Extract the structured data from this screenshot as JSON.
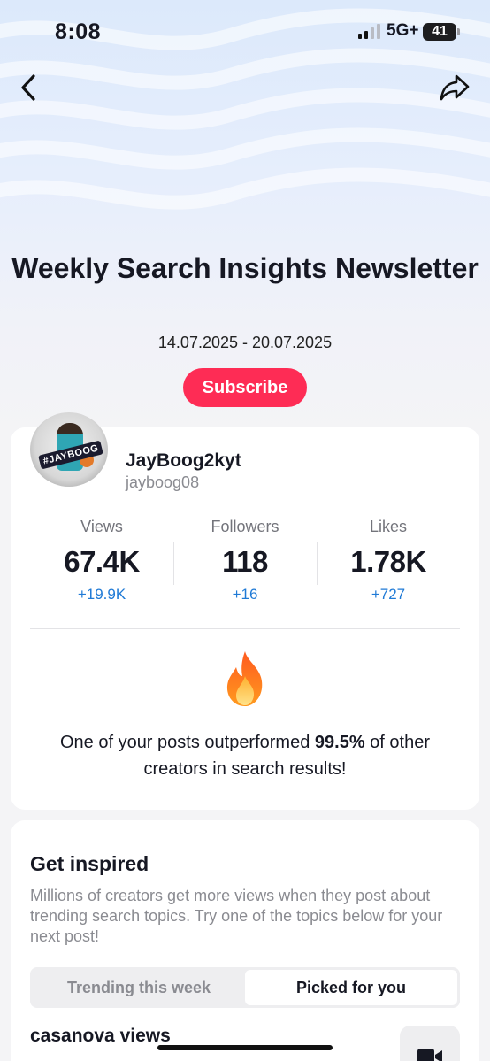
{
  "status_bar": {
    "time": "8:08",
    "network": "5G+",
    "battery": "41"
  },
  "header": {
    "title": "Weekly Search Insights Newsletter",
    "date_range": "14.07.2025 - 20.07.2025",
    "subscribe_label": "Subscribe"
  },
  "profile": {
    "display_name": "JayBoog2kyt",
    "username": "jayboog08",
    "avatar_text": "#JAYBOOG",
    "stats": [
      {
        "label": "Views",
        "value": "67.4K",
        "delta": "+19.9K"
      },
      {
        "label": "Followers",
        "value": "118",
        "delta": "+16"
      },
      {
        "label": "Likes",
        "value": "1.78K",
        "delta": "+727"
      }
    ],
    "highlight": {
      "prefix": "One of your posts outperformed ",
      "percent": "99.5%",
      "suffix": " of other creators in search results!"
    }
  },
  "inspired": {
    "title": "Get inspired",
    "description": "Millions of creators get more views when they post about trending search topics. Try one of the topics below for your next post!",
    "tabs": [
      {
        "label": "Trending this week",
        "active": false
      },
      {
        "label": "Picked for you",
        "active": true
      }
    ],
    "topics": [
      {
        "label": "casanova views"
      }
    ]
  },
  "colors": {
    "accent": "#fe2c55",
    "delta": "#1f7ad6",
    "fire": "#ff7a1a"
  },
  "icons": {
    "back": "chevron-left-icon",
    "share": "share-arrow-icon",
    "fire": "fire-icon",
    "video": "video-camera-icon"
  }
}
